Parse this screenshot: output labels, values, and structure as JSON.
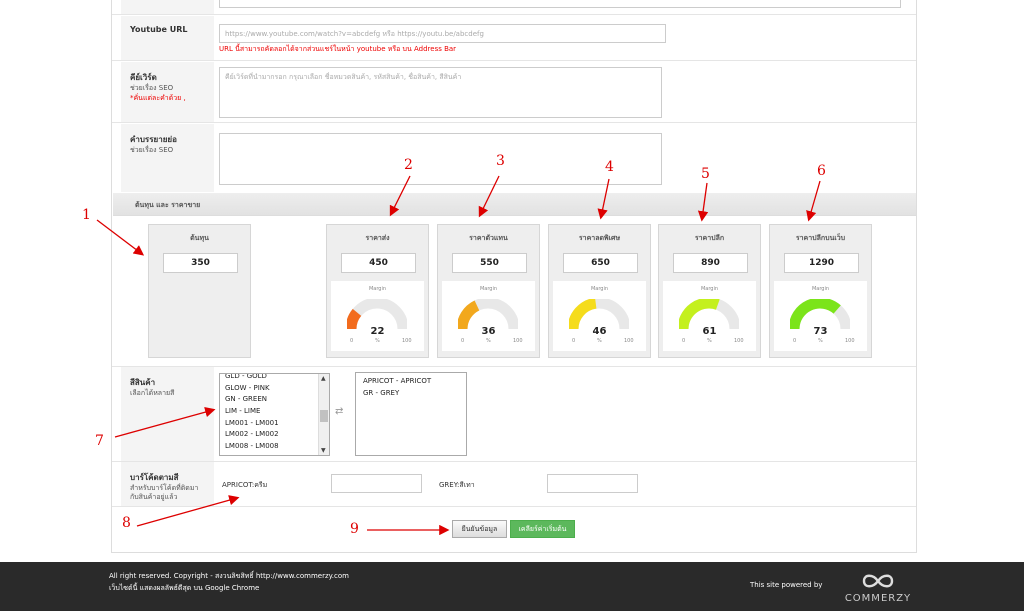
{
  "form": {
    "youtube": {
      "label": "Youtube URL",
      "placeholder": "https://www.youtube.com/watch?v=abcdefg หรือ https://youtu.be/abcdefg",
      "hint": "URL นี้สามารถคัดลอกได้จากส่วนแชร์ในหน้า youtube หรือ บน Address Bar"
    },
    "keywords": {
      "label": "คีย์เวิร์ด",
      "sub": "ช่วยเรื่อง SEO",
      "note": "*คั่นแต่ละคำด้วย ,",
      "placeholder": "คีย์เวิร์ดที่นำมากรอก กรุณาเลือก ชื่อหมวดสินค้า, รหัสสินค้า, ชื่อสินค้า, สีสินค้า"
    },
    "description": {
      "label": "คำบรรยายย่อ",
      "sub": "ช่วยเรื่อง SEO"
    },
    "pricing": {
      "section_title": "ต้นทุน และ ราคาขาย",
      "margin_label": "Margin",
      "min": "0",
      "pct": "%",
      "max": "100",
      "cost": {
        "title": "ต้นทุน",
        "value": "350"
      },
      "tiers": [
        {
          "title": "ราคาส่ง",
          "value": "450",
          "margin": "22",
          "margin_pct": 22,
          "color": "#f26b1d"
        },
        {
          "title": "ราคาตัวแทน",
          "value": "550",
          "margin": "36",
          "margin_pct": 36,
          "color": "#f2a81d"
        },
        {
          "title": "ราคาลดพิเศษ",
          "value": "650",
          "margin": "46",
          "margin_pct": 46,
          "color": "#f5dc1c"
        },
        {
          "title": "ราคาปลีก",
          "value": "890",
          "margin": "61",
          "margin_pct": 61,
          "color": "#c4f01e"
        },
        {
          "title": "ราคาปลีกบนเว็บ",
          "value": "1290",
          "margin": "73",
          "margin_pct": 73,
          "color": "#7be41a"
        }
      ]
    },
    "colors": {
      "label": "สีสินค้า",
      "sub": "เลือกได้หลายสี",
      "available": [
        "GLD - GOLD",
        "GLOW - PINK",
        "GN - GREEN",
        "LIM - LIME",
        "LM001 - LM001",
        "LM002 - LM002",
        "LM008 - LM008"
      ],
      "selected": [
        "APRICOT - APRICOT",
        "GR - GREY"
      ]
    },
    "barcode": {
      "label": "บาร์โค้ดตามสี",
      "sub1": "สำหรับบาร์โค้ดที่ติดมา",
      "sub2": "กับสินค้าอยู่แล้ว",
      "fields": [
        {
          "label": "APRICOT:ครีม",
          "value": ""
        },
        {
          "label": "GREY:สีเทา",
          "value": ""
        }
      ]
    },
    "buttons": {
      "confirm": "ยืนยันข้อมูล",
      "reset": "เคลียร์ค่าเริ่มต้น"
    }
  },
  "footer": {
    "copyright": "All right reserved. Copyright - สงวนลิขสิทธิ์ http://www.commerzy.com",
    "browser": "เว็บไซต์นี้ แสดงผลลัพธ์ดีสุด บน Google Chrome",
    "powered": "This site powered by",
    "brand": "COMMERZY"
  },
  "annotations": [
    "1",
    "2",
    "3",
    "4",
    "5",
    "6",
    "7",
    "8",
    "9"
  ],
  "annotation_color": "#dd0000"
}
